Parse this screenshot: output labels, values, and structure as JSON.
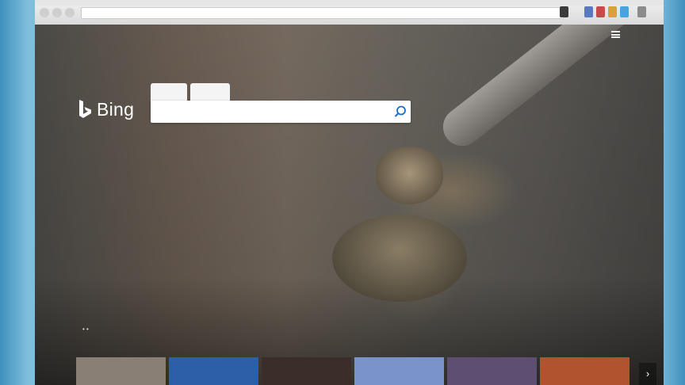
{
  "browser": {
    "address": "",
    "colors": {
      "chrome": "#dadada",
      "address_bg": "#ffffff"
    }
  },
  "topnav": {
    "links": [
      "",
      "",
      "",
      "",
      ""
    ],
    "signin": ""
  },
  "logo": {
    "text": "Bing"
  },
  "search": {
    "tabs": [
      "",
      ""
    ],
    "placeholder": "",
    "value": ""
  },
  "hero": {
    "caption": ""
  },
  "carousel": {
    "cards": [
      {
        "title": "",
        "thumb_color": "#8a7f74"
      },
      {
        "title": "",
        "thumb_color": "#2d5fa8"
      },
      {
        "title": "",
        "thumb_color": "#3a2d2a"
      },
      {
        "title": "",
        "thumb_color": "#7a93c9"
      },
      {
        "title": "",
        "thumb_color": "#5c4f72"
      },
      {
        "title": "",
        "thumb_color": "#b0532f"
      }
    ],
    "next_label": "›"
  }
}
